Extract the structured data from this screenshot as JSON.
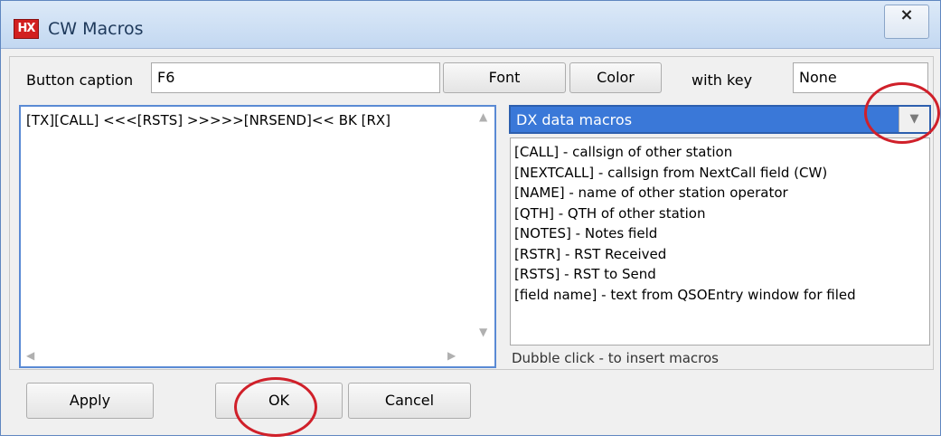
{
  "window": {
    "title": "CW Macros",
    "app_icon_text": "HX",
    "close_glyph": "×"
  },
  "toolbar": {
    "caption_label": "Button caption",
    "caption_value": "F6",
    "font_button": "Font",
    "color_button": "Color",
    "with_key_label": "with key",
    "key_value": "None"
  },
  "editor": {
    "text": "[TX][CALL] <<<[RSTS] >>>>>[NRSEND]<< BK [RX]"
  },
  "macros": {
    "selected_category": "DX data macros",
    "items": [
      "[CALL] - callsign of other station",
      "[NEXTCALL] - callsign from NextCall field (CW)",
      "[NAME] - name of other station operator",
      "[QTH] - QTH of other station",
      "[NOTES] - Notes field",
      "[RSTR] - RST Received",
      "[RSTS] - RST to Send",
      "[field name] - text from QSOEntry window for filed"
    ],
    "hint": "Dubble click - to insert macros"
  },
  "footer": {
    "apply_button": "Apply",
    "ok_button": "OK",
    "cancel_button": "Cancel"
  },
  "colors": {
    "accent": "#3a78d8",
    "highlight_ring": "#d0202a"
  }
}
